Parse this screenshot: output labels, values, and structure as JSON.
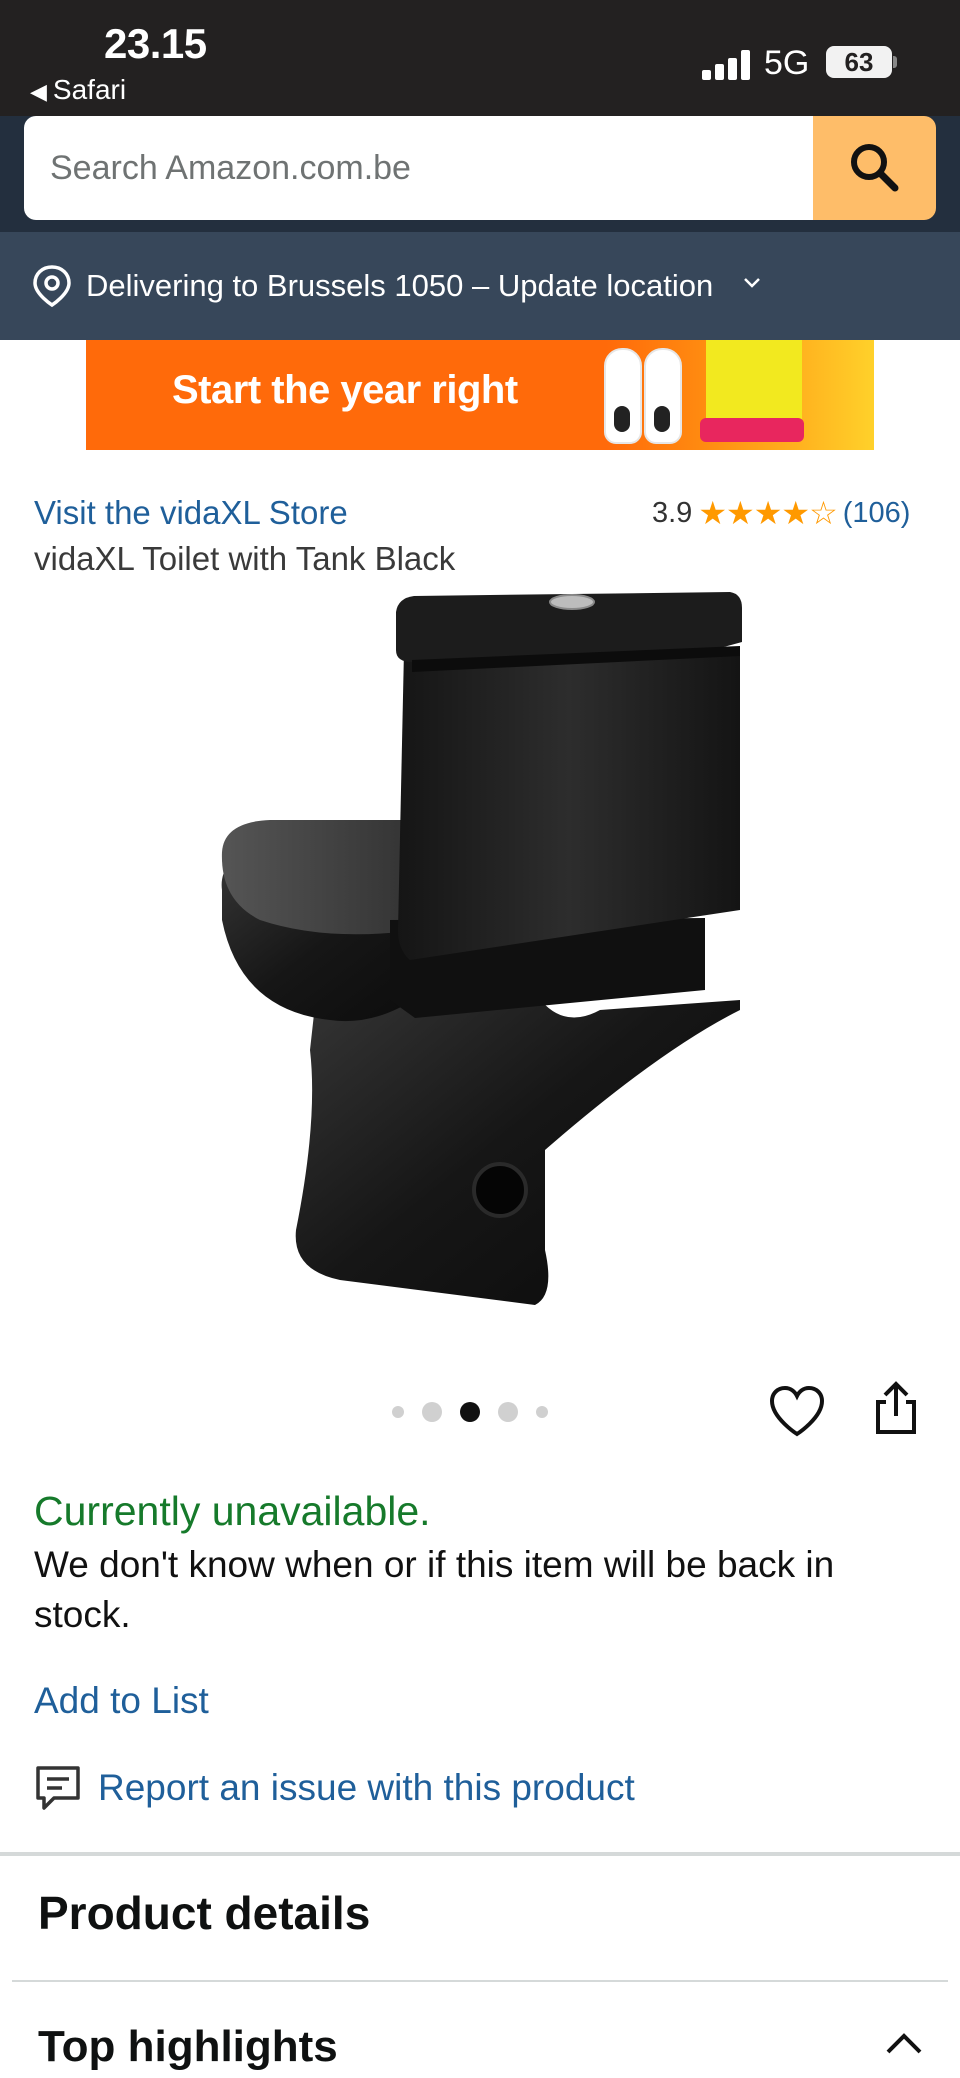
{
  "status_bar": {
    "time": "23.15",
    "back_app": "Safari",
    "network": "5G",
    "battery": "63"
  },
  "search": {
    "placeholder": "Search Amazon.com.be",
    "button_icon": "search-icon"
  },
  "delivery": {
    "text": "Delivering to Brussels 1050 – Update location",
    "icon": "location-pin-icon"
  },
  "banner": {
    "text": "Start the year right"
  },
  "product": {
    "store_link": "Visit the vidaXL Store",
    "rating": "3.9",
    "stars": "★★★★☆",
    "rating_value": 3.9,
    "rating_count": "(106)",
    "title": "vidaXL Toilet with Tank Black"
  },
  "carousel": {
    "image_count": 5,
    "active_index": 2
  },
  "availability": {
    "status": "Currently unavailable.",
    "message": "We don't know when or if this item will be back in stock.",
    "status_color": "#167a2b"
  },
  "actions": {
    "add_to_list": "Add to List",
    "report_issue": "Report an issue with this product"
  },
  "sections": {
    "product_details": "Product details",
    "top_highlights": "Top highlights"
  },
  "colors": {
    "header_bg": "#232f3e",
    "delivery_bg": "#37475a",
    "search_button": "#febd69",
    "link": "#1f5f9a",
    "star": "#ff9900"
  }
}
